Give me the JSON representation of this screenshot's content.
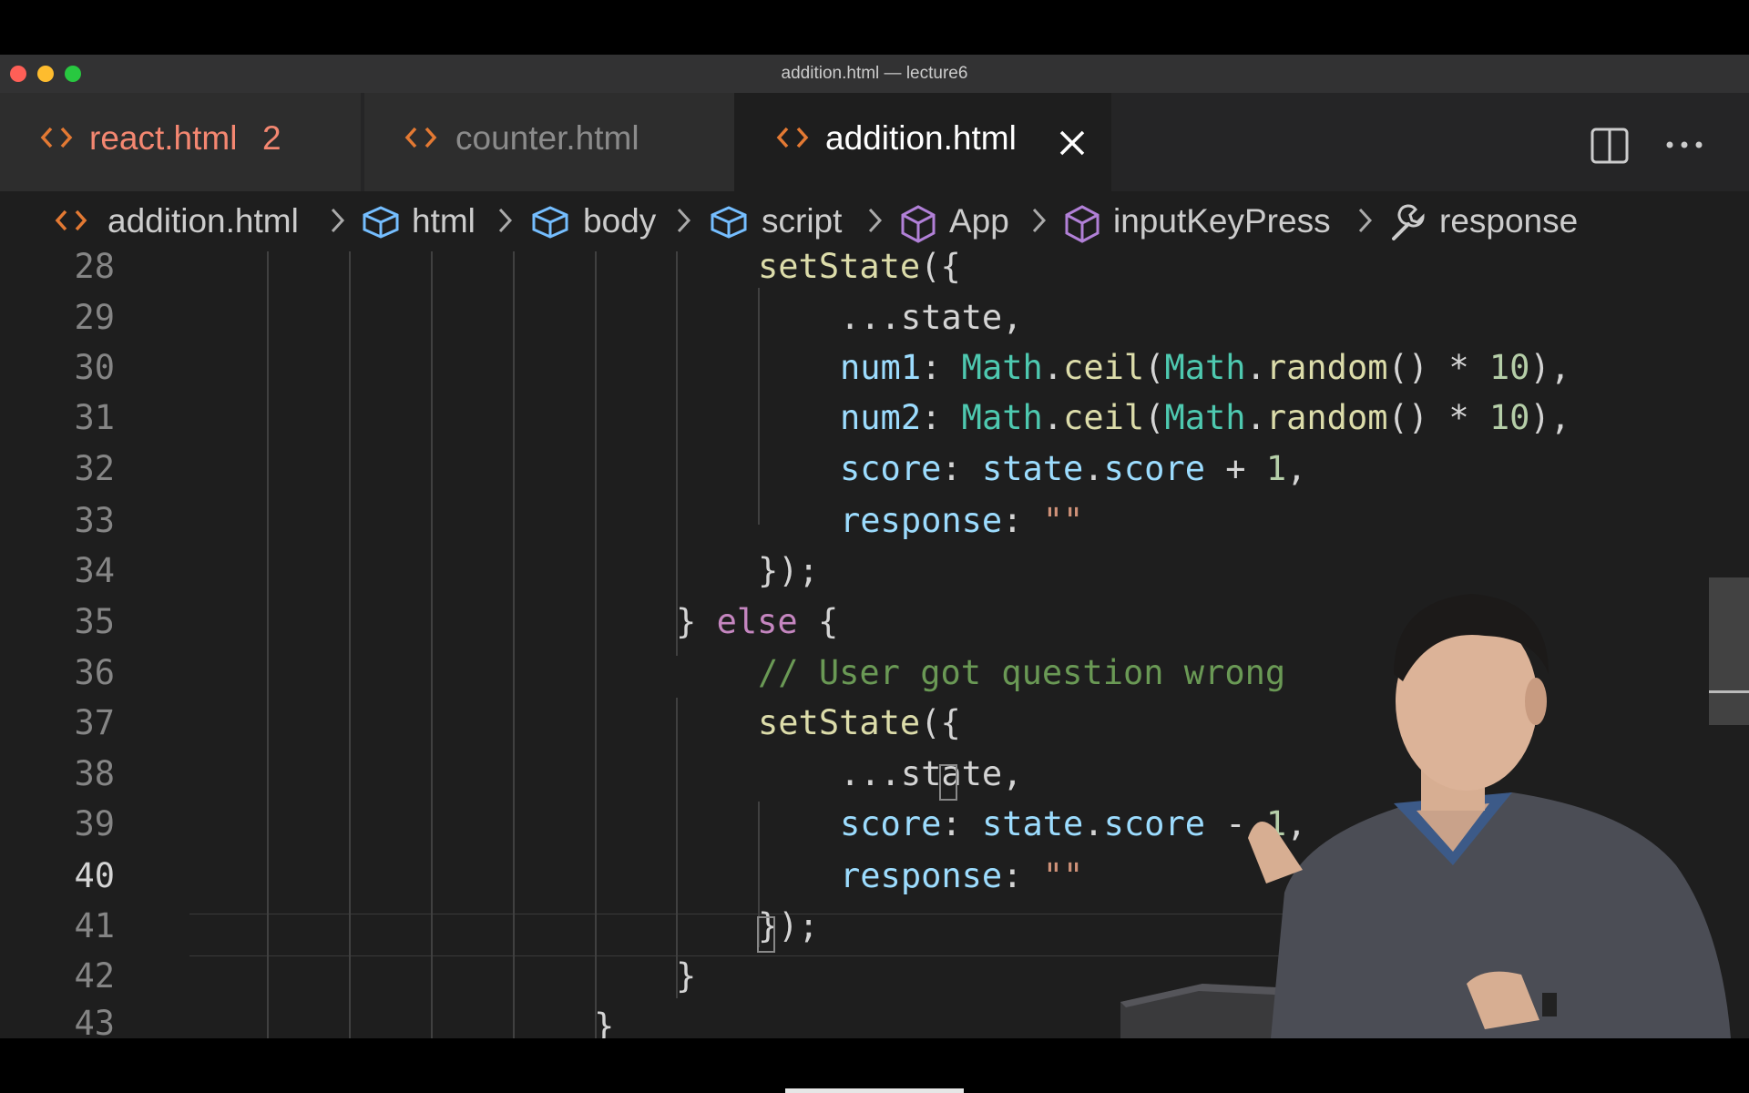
{
  "window": {
    "title": "addition.html — lecture6"
  },
  "tabs": [
    {
      "label": "react.html",
      "badge": "2",
      "color": "#f48771"
    },
    {
      "label": "counter.html",
      "color": "#8b8b8b"
    },
    {
      "label": "addition.html",
      "color": "#ffffff",
      "active": true
    }
  ],
  "breadcrumb": {
    "file": "addition.html",
    "items": [
      "html",
      "body",
      "script",
      "App",
      "inputKeyPress",
      "response"
    ]
  },
  "editor": {
    "line_numbers": [
      "28",
      "29",
      "30",
      "31",
      "32",
      "33",
      "34",
      "35",
      "36",
      "37",
      "38",
      "39",
      "40",
      "41",
      "42",
      "43"
    ],
    "active_line": "40",
    "lines": {
      "l28": {
        "fn": "setState",
        "rest": "({"
      },
      "l29": {
        "text": "...state,"
      },
      "l30": {
        "key": "num1",
        "colon": ": ",
        "cls1": "Math",
        "dot1": ".",
        "fn1": "ceil",
        "paren": "(",
        "cls2": "Math",
        "dot2": ".",
        "fn2": "random",
        "mid": "() * ",
        "num": "10",
        "end": "),"
      },
      "l31": {
        "key": "num2",
        "colon": ": ",
        "cls1": "Math",
        "dot1": ".",
        "fn1": "ceil",
        "paren": "(",
        "cls2": "Math",
        "dot2": ".",
        "fn2": "random",
        "mid": "() * ",
        "num": "10",
        "end": "),"
      },
      "l32": {
        "key": "score",
        "colon": ": ",
        "obj": "state",
        "dot": ".",
        "prop": "score",
        "op": " + ",
        "num": "1",
        "end": ","
      },
      "l33": {
        "key": "response",
        "colon": ": ",
        "str": "\"\""
      },
      "l34": {
        "text": "});"
      },
      "l35": {
        "brace1": "} ",
        "kw": "else",
        "brace2": " {"
      },
      "l36": {
        "comment": "// User got question wrong"
      },
      "l37": {
        "fn": "setState",
        "rest": "({"
      },
      "l38": {
        "text": "...state,"
      },
      "l39": {
        "key": "score",
        "colon": ": ",
        "obj": "state",
        "dot": ".",
        "prop": "score",
        "op": " - ",
        "num": "1",
        "end": ","
      },
      "l40": {
        "key": "response",
        "colon": ": ",
        "str": "\"\""
      },
      "l41": {
        "text": "});"
      },
      "l42": {
        "text": "}"
      },
      "l43": {
        "text": "}"
      }
    }
  }
}
